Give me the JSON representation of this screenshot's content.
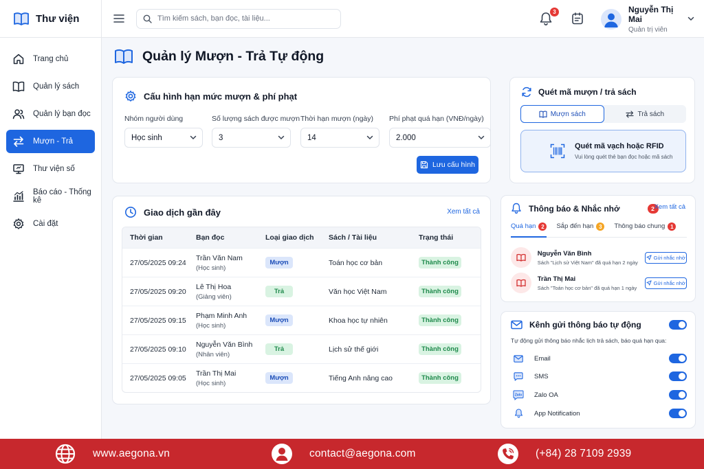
{
  "app": {
    "name": "Thư viện"
  },
  "search": {
    "placeholder": "Tìm kiếm sách, bạn đọc, tài liệu..."
  },
  "notifications_count": "3",
  "user": {
    "name": "Nguyễn Thị Mai",
    "role": "Quản trị viên"
  },
  "sidebar": {
    "items": [
      {
        "label": "Trang chủ",
        "icon": "home-icon"
      },
      {
        "label": "Quản lý sách",
        "icon": "book-open-icon"
      },
      {
        "label": "Quản lý bạn đọc",
        "icon": "users-icon"
      },
      {
        "label": "Mượn - Trả",
        "icon": "arrows-swap-icon",
        "active": true
      },
      {
        "label": "Thư viện số",
        "icon": "monitor-icon"
      },
      {
        "label": "Báo cáo - Thống kê",
        "icon": "chart-icon"
      },
      {
        "label": "Cài đặt",
        "icon": "gear-icon"
      }
    ]
  },
  "page": {
    "title": "Quản lý Mượn - Trả Tự động"
  },
  "config": {
    "title": "Cấu hình hạn mức mượn & phí phạt",
    "fields": [
      {
        "label": "Nhóm người dùng",
        "value": "Học sinh"
      },
      {
        "label": "Số lượng sách được mượn",
        "value": "3"
      },
      {
        "label": "Thời hạn mượn (ngày)",
        "value": "14"
      },
      {
        "label": "Phí phạt quá hạn (VNĐ/ngày)",
        "value": "2.000"
      }
    ],
    "save_label": "Lưu cấu hình"
  },
  "transactions": {
    "title": "Giao dịch gần đây",
    "view_all": "Xem tất cả",
    "columns": [
      "Thời gian",
      "Bạn đọc",
      "Loại giao dịch",
      "Sách / Tài liệu",
      "Trạng thái"
    ],
    "rows": [
      {
        "time": "27/05/2025  09:24",
        "reader": "Trần Văn Nam",
        "reader_role": "(Học sinh)",
        "type": "Mượn",
        "book": "Toán học cơ bản",
        "status": "Thành công"
      },
      {
        "time": "27/05/2025  09:20",
        "reader": "Lê Thị Hoa",
        "reader_role": "(Giảng viên)",
        "type": "Trả",
        "book": "Văn học Việt Nam",
        "status": "Thành công"
      },
      {
        "time": "27/05/2025  09:15",
        "reader": "Phạm Minh Anh",
        "reader_role": "(Học sinh)",
        "type": "Mượn",
        "book": "Khoa học tự nhiên",
        "status": "Thành công"
      },
      {
        "time": "27/05/2025  09:10",
        "reader": "Nguyễn Văn Bình",
        "reader_role": "(Nhân viên)",
        "type": "Trả",
        "book": "Lịch sử thế giới",
        "status": "Thành công"
      },
      {
        "time": "27/05/2025  09:05",
        "reader": "Trần Thị Mai",
        "reader_role": "(Học sinh)",
        "type": "Mượn",
        "book": "Tiếng Anh nâng cao",
        "status": "Thành công"
      }
    ]
  },
  "scan": {
    "title": "Quét mã mượn / trả sách",
    "tab_borrow": "Mượn sách",
    "tab_return": "Trả sách",
    "box_title": "Quét mã vạch hoặc RFID",
    "box_sub": "Vui lòng quét thẻ bạn đọc hoặc mã sách"
  },
  "notices": {
    "title": "Thông báo & Nhắc nhở",
    "count": "2",
    "view_all": "Xem tất cả",
    "tabs": [
      {
        "label": "Quá hạn",
        "count": "2"
      },
      {
        "label": "Sắp đến hạn",
        "count": "3"
      },
      {
        "label": "Thông báo chung",
        "count": "1"
      }
    ],
    "items": [
      {
        "name": "Nguyễn Văn Bình",
        "desc": "Sách \"Lịch sử Việt Nam\" đã quá hạn 2 ngày",
        "action": "Gửi nhắc nhở"
      },
      {
        "name": "Trần Thị Mai",
        "desc": "Sách \"Toán học cơ bản\" đã quá hạn 1 ngày",
        "action": "Gửi nhắc nhở"
      }
    ]
  },
  "channels": {
    "title": "Kênh gửi thông báo tự động",
    "desc": "Tự động gửi thông báo nhắc lịch trả sách, báo quá hạn qua:",
    "items": [
      {
        "label": "Email",
        "enabled": true
      },
      {
        "label": "SMS",
        "enabled": true
      },
      {
        "label": "Zalo OA",
        "enabled": true,
        "icon_text": "Zalo"
      },
      {
        "label": "App Notification",
        "enabled": true
      }
    ]
  },
  "footer": {
    "website": "www.aegona.vn",
    "email": "contact@aegona.com",
    "phone": "(+84) 28 7109 2939"
  },
  "colors": {
    "accent": "#1e66e0",
    "footer": "#c7282d",
    "success": "#1f8a4c",
    "danger": "#e53935"
  }
}
